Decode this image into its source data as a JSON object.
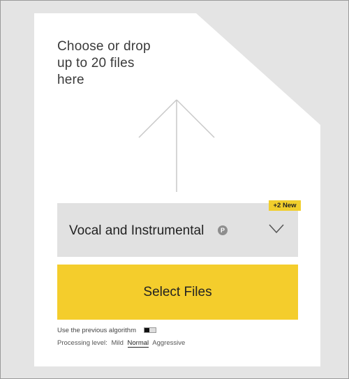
{
  "upload": {
    "instruction_line1": "Choose or drop",
    "instruction_line2": "up to 20 files",
    "instruction_line3": "here"
  },
  "separation": {
    "selected": "Vocal and Instrumental",
    "premium_mark": "P",
    "new_badge": "+2 New"
  },
  "select_button": {
    "label": "Select Files"
  },
  "options": {
    "previous_algorithm_label": "Use the previous algorithm",
    "previous_algorithm_enabled": false,
    "processing_label": "Processing level:",
    "levels": [
      "Mild",
      "Normal",
      "Aggressive"
    ],
    "selected_level": "Normal"
  },
  "colors": {
    "accent_yellow": "#f4cd2c",
    "dropdown_bg": "#e1e1e1",
    "page_bg": "#e4e4e4"
  }
}
